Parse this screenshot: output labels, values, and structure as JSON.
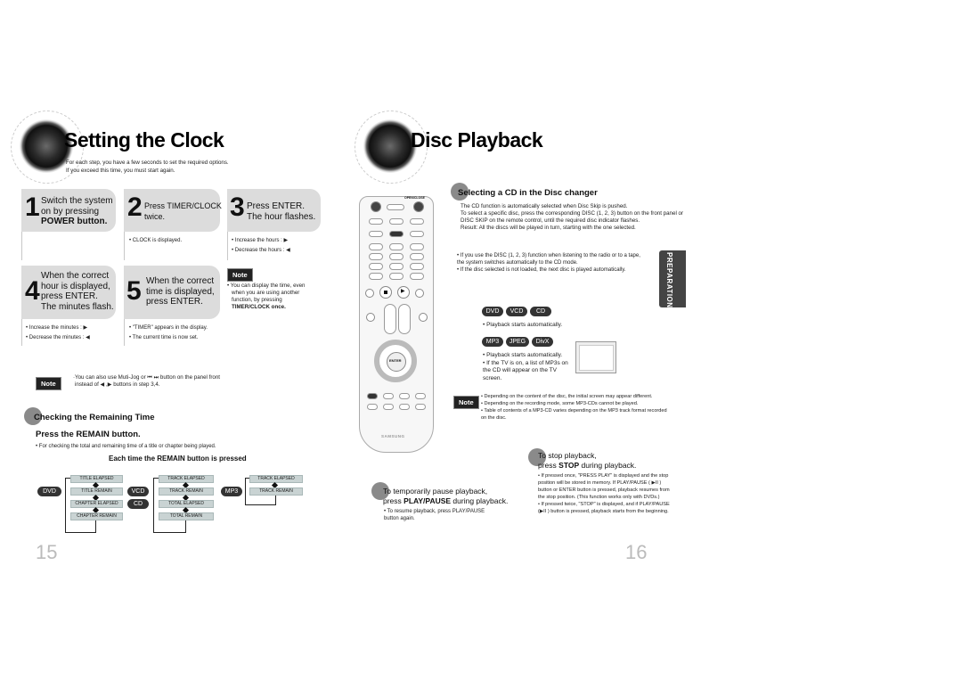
{
  "left_page": {
    "title": "Setting the Clock",
    "intro": [
      "For each step, you have a few seconds to set the required options.",
      "If you exceed this time, you must start again."
    ],
    "steps": [
      {
        "num": "1",
        "lines": [
          "Switch the system",
          "on by pressing",
          "POWER button."
        ],
        "bullets": []
      },
      {
        "num": "2",
        "lines": [
          "Press TIMER/CLOCK",
          "twice."
        ],
        "bullets": [
          "CLOCK is displayed."
        ]
      },
      {
        "num": "3",
        "lines": [
          "Press ENTER.",
          "The hour flashes."
        ],
        "bullets": [
          "Increase the hours : ▶",
          "Decrease the hours : ◀"
        ]
      },
      {
        "num": "4",
        "lines": [
          "When the correct",
          "hour is displayed,",
          "press ENTER.",
          "The minutes flash."
        ],
        "bullets": [
          "Increase the minutes : ▶",
          "Decrease the minutes : ◀"
        ]
      },
      {
        "num": "5",
        "lines": [
          "When the correct",
          "time is displayed,",
          "press ENTER."
        ],
        "bullets": [
          "\"TIMER\" appears in the display.",
          "The current time is now set."
        ]
      }
    ],
    "note_right": {
      "badge": "Note",
      "text": [
        "You can display the time, even",
        "when you are using another",
        "function, by pressing",
        "TIMER/CLOCK once."
      ]
    },
    "note_bottom": {
      "badge": "Note",
      "text": [
        "·You can also  use Muti-Jog or  ⏮ ⏭ button on  the panel front",
        "instead of ◀ ,▶  buttons in step 3,4."
      ]
    },
    "remaining": {
      "heading": "Checking the Remaining Time",
      "subheading": "Press the REMAIN button.",
      "bullet": "For checking the total and remaining time of a title or chapter being played.",
      "caption": "Each time the REMAIN button is pressed",
      "flows": [
        {
          "labels": [
            "DVD"
          ],
          "items": [
            "TITLE ELAPSED",
            "TITLE REMAIN",
            "CHAPTER ELAPSED",
            "CHAPTER REMAIN"
          ]
        },
        {
          "labels": [
            "VCD",
            "CD"
          ],
          "items": [
            "TRACK ELAPSED",
            "TRACK REMAIN",
            "TOTAL ELAPSED",
            "TOTAL REMAIN"
          ]
        },
        {
          "labels": [
            "MP3"
          ],
          "items": [
            "TRACK ELAPSED",
            "TRACK REMAIN"
          ]
        }
      ]
    },
    "page_number": "15"
  },
  "right_page": {
    "title": "Disc Playback",
    "remote": {
      "brand": "SAMSUNG",
      "open_close": "OPEN/CLOSE",
      "enter": "ENTER",
      "timer_clock": "TIMER/CLOCK"
    },
    "selecting": {
      "heading": "Selecting a CD in the Disc changer",
      "lines": [
        "The CD function is automatically selected when Disc Skip is pushed.",
        "To select a specific disc, press the corresponding DISC (1, 2, 3) button on the front panel or",
        "DISC SKIP on the remote control, until the required disc indicator flashes.",
        "Result: All the discs will be played in turn, starting with the one selected."
      ],
      "bullets": [
        "If you use the DISC (1, 2, 3) function when listening to the radio or to a tape, the system switches automatically to the CD mode.",
        "If the disc selected is not loaded, the next disc is played automatically."
      ]
    },
    "side_tab": "PREPARATION",
    "formats_1": {
      "pills": [
        "DVD",
        "VCD",
        "CD"
      ],
      "bullets": [
        "Playback starts automatically."
      ]
    },
    "formats_2": {
      "pills": [
        "MP3",
        "JPEG",
        "DivX"
      ],
      "bullets": [
        "Playback starts automatically.",
        "If the TV is on, a list of MP3s on the CD will appear on the TV screen."
      ]
    },
    "note": {
      "badge": "Note",
      "bullets": [
        "Depending on the content of the disc, the initial screen may appear different.",
        "Depending on the recording mode, some MP3-CDs cannot be played.",
        "Table of contents of a MP3-CD varies depending on the MP3 track format recorded on the disc."
      ]
    },
    "pause": {
      "heading_1": "To temporarily pause playback,",
      "heading_2": "press PLAY/PAUSE during playback.",
      "bullet": "To resume playback, press PLAY/PAUSE button again."
    },
    "stop": {
      "heading_1": "To stop playback,",
      "heading_2": "press STOP during playback.",
      "bullets": [
        "If pressed once, \"PRESS PLAY\" is displayed and the stop position will be stored in memory. If PLAY/PAUSE ( ▶II ) button or ENTER button is pressed, playback resumes from the stop position. (This function works only with DVDs.)",
        "If pressed twice, \"STOP\" is displayed, and if PLAY/PAUSE (▶II ) button is pressed, playback starts from the beginning."
      ]
    },
    "page_number": "16"
  }
}
